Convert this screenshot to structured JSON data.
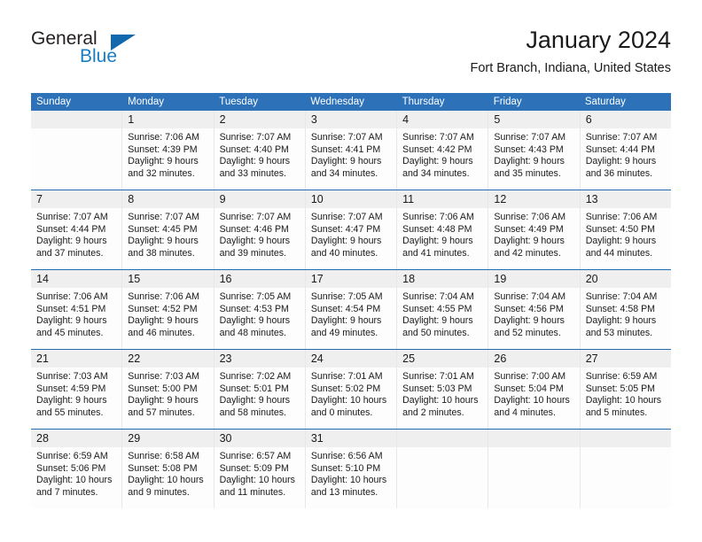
{
  "logo": {
    "word_top": "General",
    "word_bottom": "Blue",
    "triangle_color": "#1168ad",
    "blue_color": "#1a7dc4"
  },
  "header": {
    "title": "January 2024",
    "location": "Fort Branch, Indiana, United States"
  },
  "theme": {
    "header_blue": "#2d72b8",
    "row_rule_blue": "#1f6cb0",
    "day_band_gray": "#efefef"
  },
  "weekday_names": [
    "Sunday",
    "Monday",
    "Tuesday",
    "Wednesday",
    "Thursday",
    "Friday",
    "Saturday"
  ],
  "weeks": [
    [
      {
        "day": "",
        "empty": true
      },
      {
        "day": "1",
        "sunrise": "Sunrise: 7:06 AM",
        "sunset": "Sunset: 4:39 PM",
        "daylight1": "Daylight: 9 hours",
        "daylight2": "and 32 minutes."
      },
      {
        "day": "2",
        "sunrise": "Sunrise: 7:07 AM",
        "sunset": "Sunset: 4:40 PM",
        "daylight1": "Daylight: 9 hours",
        "daylight2": "and 33 minutes."
      },
      {
        "day": "3",
        "sunrise": "Sunrise: 7:07 AM",
        "sunset": "Sunset: 4:41 PM",
        "daylight1": "Daylight: 9 hours",
        "daylight2": "and 34 minutes."
      },
      {
        "day": "4",
        "sunrise": "Sunrise: 7:07 AM",
        "sunset": "Sunset: 4:42 PM",
        "daylight1": "Daylight: 9 hours",
        "daylight2": "and 34 minutes."
      },
      {
        "day": "5",
        "sunrise": "Sunrise: 7:07 AM",
        "sunset": "Sunset: 4:43 PM",
        "daylight1": "Daylight: 9 hours",
        "daylight2": "and 35 minutes."
      },
      {
        "day": "6",
        "sunrise": "Sunrise: 7:07 AM",
        "sunset": "Sunset: 4:44 PM",
        "daylight1": "Daylight: 9 hours",
        "daylight2": "and 36 minutes."
      }
    ],
    [
      {
        "day": "7",
        "sunrise": "Sunrise: 7:07 AM",
        "sunset": "Sunset: 4:44 PM",
        "daylight1": "Daylight: 9 hours",
        "daylight2": "and 37 minutes."
      },
      {
        "day": "8",
        "sunrise": "Sunrise: 7:07 AM",
        "sunset": "Sunset: 4:45 PM",
        "daylight1": "Daylight: 9 hours",
        "daylight2": "and 38 minutes."
      },
      {
        "day": "9",
        "sunrise": "Sunrise: 7:07 AM",
        "sunset": "Sunset: 4:46 PM",
        "daylight1": "Daylight: 9 hours",
        "daylight2": "and 39 minutes."
      },
      {
        "day": "10",
        "sunrise": "Sunrise: 7:07 AM",
        "sunset": "Sunset: 4:47 PM",
        "daylight1": "Daylight: 9 hours",
        "daylight2": "and 40 minutes."
      },
      {
        "day": "11",
        "sunrise": "Sunrise: 7:06 AM",
        "sunset": "Sunset: 4:48 PM",
        "daylight1": "Daylight: 9 hours",
        "daylight2": "and 41 minutes."
      },
      {
        "day": "12",
        "sunrise": "Sunrise: 7:06 AM",
        "sunset": "Sunset: 4:49 PM",
        "daylight1": "Daylight: 9 hours",
        "daylight2": "and 42 minutes."
      },
      {
        "day": "13",
        "sunrise": "Sunrise: 7:06 AM",
        "sunset": "Sunset: 4:50 PM",
        "daylight1": "Daylight: 9 hours",
        "daylight2": "and 44 minutes."
      }
    ],
    [
      {
        "day": "14",
        "sunrise": "Sunrise: 7:06 AM",
        "sunset": "Sunset: 4:51 PM",
        "daylight1": "Daylight: 9 hours",
        "daylight2": "and 45 minutes."
      },
      {
        "day": "15",
        "sunrise": "Sunrise: 7:06 AM",
        "sunset": "Sunset: 4:52 PM",
        "daylight1": "Daylight: 9 hours",
        "daylight2": "and 46 minutes."
      },
      {
        "day": "16",
        "sunrise": "Sunrise: 7:05 AM",
        "sunset": "Sunset: 4:53 PM",
        "daylight1": "Daylight: 9 hours",
        "daylight2": "and 48 minutes."
      },
      {
        "day": "17",
        "sunrise": "Sunrise: 7:05 AM",
        "sunset": "Sunset: 4:54 PM",
        "daylight1": "Daylight: 9 hours",
        "daylight2": "and 49 minutes."
      },
      {
        "day": "18",
        "sunrise": "Sunrise: 7:04 AM",
        "sunset": "Sunset: 4:55 PM",
        "daylight1": "Daylight: 9 hours",
        "daylight2": "and 50 minutes."
      },
      {
        "day": "19",
        "sunrise": "Sunrise: 7:04 AM",
        "sunset": "Sunset: 4:56 PM",
        "daylight1": "Daylight: 9 hours",
        "daylight2": "and 52 minutes."
      },
      {
        "day": "20",
        "sunrise": "Sunrise: 7:04 AM",
        "sunset": "Sunset: 4:58 PM",
        "daylight1": "Daylight: 9 hours",
        "daylight2": "and 53 minutes."
      }
    ],
    [
      {
        "day": "21",
        "sunrise": "Sunrise: 7:03 AM",
        "sunset": "Sunset: 4:59 PM",
        "daylight1": "Daylight: 9 hours",
        "daylight2": "and 55 minutes."
      },
      {
        "day": "22",
        "sunrise": "Sunrise: 7:03 AM",
        "sunset": "Sunset: 5:00 PM",
        "daylight1": "Daylight: 9 hours",
        "daylight2": "and 57 minutes."
      },
      {
        "day": "23",
        "sunrise": "Sunrise: 7:02 AM",
        "sunset": "Sunset: 5:01 PM",
        "daylight1": "Daylight: 9 hours",
        "daylight2": "and 58 minutes."
      },
      {
        "day": "24",
        "sunrise": "Sunrise: 7:01 AM",
        "sunset": "Sunset: 5:02 PM",
        "daylight1": "Daylight: 10 hours",
        "daylight2": "and 0 minutes."
      },
      {
        "day": "25",
        "sunrise": "Sunrise: 7:01 AM",
        "sunset": "Sunset: 5:03 PM",
        "daylight1": "Daylight: 10 hours",
        "daylight2": "and 2 minutes."
      },
      {
        "day": "26",
        "sunrise": "Sunrise: 7:00 AM",
        "sunset": "Sunset: 5:04 PM",
        "daylight1": "Daylight: 10 hours",
        "daylight2": "and 4 minutes."
      },
      {
        "day": "27",
        "sunrise": "Sunrise: 6:59 AM",
        "sunset": "Sunset: 5:05 PM",
        "daylight1": "Daylight: 10 hours",
        "daylight2": "and 5 minutes."
      }
    ],
    [
      {
        "day": "28",
        "sunrise": "Sunrise: 6:59 AM",
        "sunset": "Sunset: 5:06 PM",
        "daylight1": "Daylight: 10 hours",
        "daylight2": "and 7 minutes."
      },
      {
        "day": "29",
        "sunrise": "Sunrise: 6:58 AM",
        "sunset": "Sunset: 5:08 PM",
        "daylight1": "Daylight: 10 hours",
        "daylight2": "and 9 minutes."
      },
      {
        "day": "30",
        "sunrise": "Sunrise: 6:57 AM",
        "sunset": "Sunset: 5:09 PM",
        "daylight1": "Daylight: 10 hours",
        "daylight2": "and 11 minutes."
      },
      {
        "day": "31",
        "sunrise": "Sunrise: 6:56 AM",
        "sunset": "Sunset: 5:10 PM",
        "daylight1": "Daylight: 10 hours",
        "daylight2": "and 13 minutes."
      },
      {
        "day": "",
        "empty": true
      },
      {
        "day": "",
        "empty": true
      },
      {
        "day": "",
        "empty": true
      }
    ]
  ]
}
